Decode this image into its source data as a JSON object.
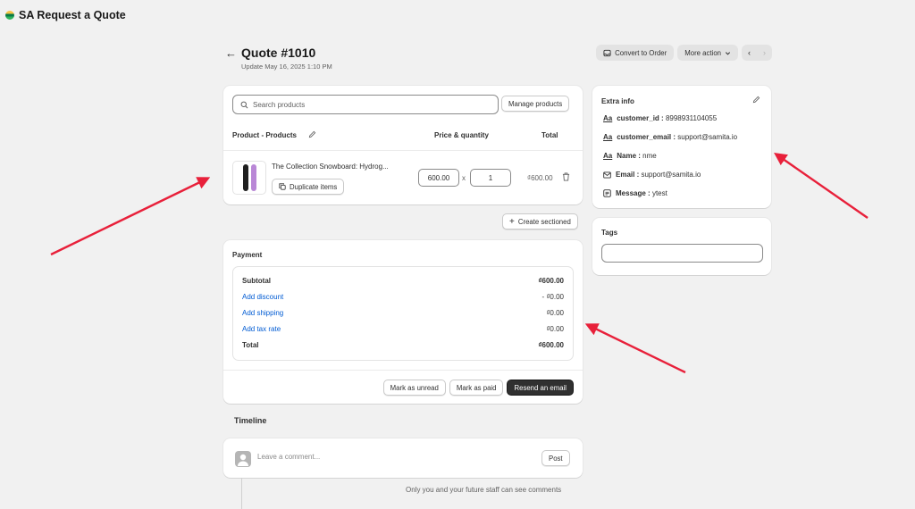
{
  "app": {
    "title": "SA Request a Quote"
  },
  "header": {
    "title": "Quote #1010",
    "subtitle": "Update May 16, 2025 1:10 PM",
    "convert_label": "Convert to Order",
    "more_label": "More action"
  },
  "products": {
    "search_placeholder": "Search products",
    "manage_label": "Manage products",
    "col_product": "Product - Products",
    "col_price_qty": "Price & quantity",
    "col_total": "Total",
    "item": {
      "name": "The Collection Snowboard: Hydrog...",
      "duplicate_label": "Duplicate items",
      "price": "600.00",
      "times": "x",
      "quantity": "1",
      "total": "₫600.00"
    }
  },
  "create_sectioned_label": "Create sectioned",
  "payment": {
    "title": "Payment",
    "rows": [
      {
        "label": "Subtotal",
        "value": "₫600.00"
      },
      {
        "label": "Add discount",
        "value": "- ₫0.00"
      },
      {
        "label": "Add shipping",
        "value": "₫0.00"
      },
      {
        "label": "Add tax rate",
        "value": "₫0.00"
      },
      {
        "label": "Total",
        "value": "₫600.00"
      }
    ],
    "mark_unread_label": "Mark as unread",
    "mark_paid_label": "Mark as paid",
    "resend_label": "Resend an email"
  },
  "timeline": {
    "title": "Timeline",
    "comment_placeholder": "Leave a comment...",
    "post_label": "Post",
    "note": "Only you and your future staff can see comments"
  },
  "extra_info": {
    "title": "Extra info",
    "rows": [
      {
        "key": "customer_id",
        "sep": ":",
        "value": "8998931104055",
        "icon": "text-field-icon"
      },
      {
        "key": "customer_email",
        "sep": ":",
        "value": "support@samita.io",
        "icon": "text-field-icon"
      },
      {
        "key": "Name",
        "sep": ":",
        "value": "nme",
        "icon": "text-field-icon"
      },
      {
        "key": "Email",
        "sep": ":",
        "value": "support@samita.io",
        "icon": "email-icon"
      },
      {
        "key": "Message",
        "sep": ":",
        "value": "ytest",
        "icon": "message-icon"
      }
    ]
  },
  "tags": {
    "title": "Tags"
  },
  "colors": {
    "annotation_arrow": "#e8203a",
    "link": "#005bd3",
    "primary_button": "#303030"
  }
}
